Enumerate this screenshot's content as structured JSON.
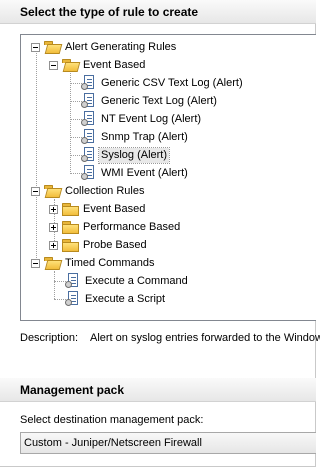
{
  "rule_section": {
    "title": "Select the type of rule to create"
  },
  "tree": {
    "alert_rules": "Alert Generating Rules",
    "alert_event_based": "Event Based",
    "alert_items": [
      "Generic CSV Text Log (Alert)",
      "Generic Text Log (Alert)",
      "NT Event Log (Alert)",
      "Snmp Trap (Alert)",
      "Syslog (Alert)",
      "WMI Event (Alert)"
    ],
    "selected_item": "Syslog (Alert)",
    "collection_rules": "Collection Rules",
    "collection_items": [
      "Event Based",
      "Performance Based",
      "Probe Based"
    ],
    "timed_commands": "Timed Commands",
    "timed_items": [
      "Execute a Command",
      "Execute a Script"
    ]
  },
  "description": {
    "label": "Description:",
    "text": "Alert on syslog entries forwarded to the Window"
  },
  "management_pack": {
    "title": "Management pack",
    "select_label": "Select destination management pack:",
    "selected": "Custom - Juniper/Netscreen Firewall"
  }
}
